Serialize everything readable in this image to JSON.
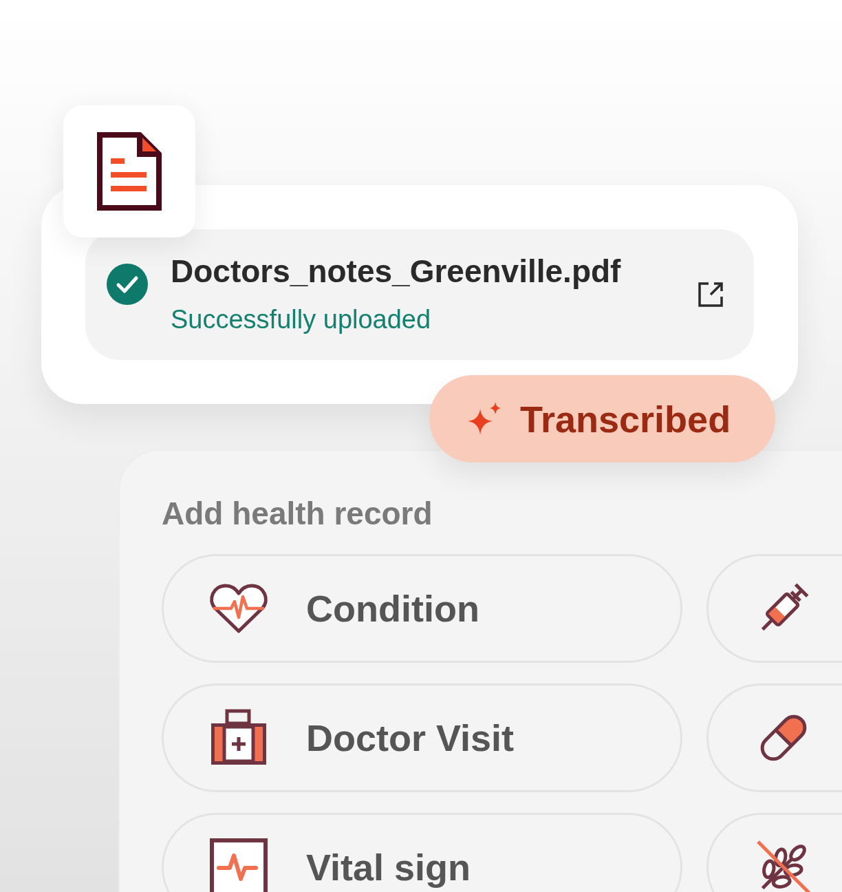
{
  "upload": {
    "file_name": "Doctors_notes_Greenville.pdf",
    "status": "Successfully uploaded"
  },
  "badge": {
    "label": "Transcribed"
  },
  "records": {
    "title": "Add health record",
    "options": [
      {
        "kind": "heart",
        "label": "Condition"
      },
      {
        "kind": "syringe"
      },
      {
        "kind": "kit",
        "label": "Doctor Visit"
      },
      {
        "kind": "pill"
      },
      {
        "kind": "vitals",
        "label": "Vital sign"
      },
      {
        "kind": "grain"
      }
    ]
  }
}
